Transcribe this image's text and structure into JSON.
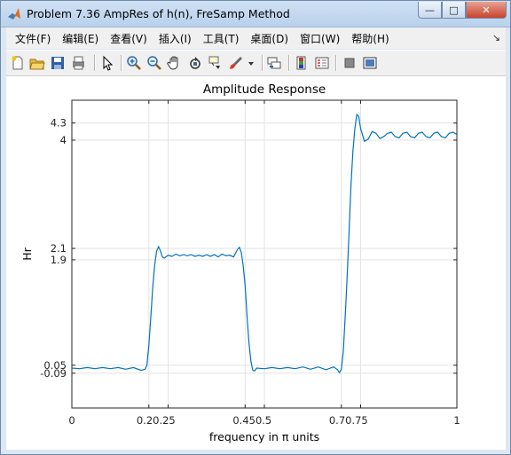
{
  "window": {
    "title": "Problem 7.36 AmpRes of h(n), FreSamp Method",
    "buttons": [
      "minimize",
      "maximize",
      "close"
    ]
  },
  "menu": [
    "文件(F)",
    "编辑(E)",
    "查看(V)",
    "插入(I)",
    "工具(T)",
    "桌面(D)",
    "窗口(W)",
    "帮助(H)"
  ],
  "toolbar": [
    "new-figure-icon",
    "open-icon",
    "save-icon",
    "print-icon",
    "pointer-icon",
    "zoom-in-icon",
    "zoom-out-icon",
    "pan-hand-icon",
    "rotate-3d-icon",
    "data-cursor-icon",
    "brush-icon",
    "brush-dropdown-icon",
    "link-plot-icon",
    "insert-colorbar-icon",
    "insert-legend-icon",
    "hide-plot-tools-icon",
    "show-plot-tools-icon"
  ],
  "chart_data": {
    "type": "line",
    "title": "Amplitude Response",
    "xlabel": "frequency in π units",
    "ylabel": "Hr",
    "xlim": [
      0,
      1
    ],
    "ylim": [
      -0.7,
      4.7
    ],
    "grid": true,
    "xticks": [
      0,
      0.2,
      0.25,
      0.45,
      0.5,
      0.7,
      0.75,
      1
    ],
    "xtick_labels": [
      "0",
      "0.20.25",
      "",
      "0.450.5",
      "",
      "0.70.75",
      "",
      "1"
    ],
    "yticks": [
      -0.09,
      0.05,
      1.9,
      2.1,
      4,
      4.3
    ],
    "ytick_labels": [
      "-0.09",
      "0.05",
      "1.9",
      "2.1",
      "4",
      "4.3"
    ],
    "series": [
      {
        "color": "#0072bd",
        "x": [
          0,
          0.02,
          0.04,
          0.06,
          0.08,
          0.1,
          0.12,
          0.14,
          0.16,
          0.18,
          0.19,
          0.195,
          0.2,
          0.205,
          0.21,
          0.215,
          0.22,
          0.225,
          0.23,
          0.235,
          0.24,
          0.25,
          0.26,
          0.27,
          0.28,
          0.29,
          0.3,
          0.31,
          0.32,
          0.33,
          0.34,
          0.35,
          0.36,
          0.37,
          0.38,
          0.39,
          0.4,
          0.41,
          0.42,
          0.43,
          0.435,
          0.44,
          0.445,
          0.45,
          0.455,
          0.46,
          0.465,
          0.47,
          0.475,
          0.48,
          0.5,
          0.52,
          0.54,
          0.56,
          0.58,
          0.6,
          0.62,
          0.64,
          0.66,
          0.68,
          0.69,
          0.695,
          0.7,
          0.705,
          0.71,
          0.715,
          0.72,
          0.725,
          0.73,
          0.735,
          0.74,
          0.745,
          0.75,
          0.76,
          0.77,
          0.78,
          0.79,
          0.8,
          0.81,
          0.82,
          0.83,
          0.84,
          0.85,
          0.86,
          0.87,
          0.88,
          0.89,
          0.9,
          0.91,
          0.92,
          0.93,
          0.94,
          0.95,
          0.96,
          0.97,
          0.98,
          0.99,
          1.0
        ],
        "y": [
          0.0,
          -0.01,
          0.01,
          -0.01,
          0.01,
          -0.01,
          0.01,
          -0.02,
          0.01,
          -0.04,
          -0.02,
          0.05,
          0.4,
          0.9,
          1.4,
          1.8,
          2.05,
          2.13,
          2.06,
          1.95,
          1.93,
          1.98,
          1.96,
          2.0,
          1.97,
          1.99,
          1.97,
          1.99,
          1.96,
          1.98,
          1.96,
          1.99,
          1.96,
          1.99,
          1.95,
          2.0,
          1.97,
          1.98,
          1.95,
          2.08,
          2.12,
          2.03,
          1.8,
          1.45,
          0.9,
          0.45,
          0.12,
          -0.04,
          -0.05,
          0.0,
          -0.01,
          0.01,
          -0.01,
          0.01,
          -0.01,
          0.02,
          -0.02,
          0.02,
          -0.03,
          0.02,
          -0.03,
          -0.08,
          -0.02,
          0.3,
          0.9,
          1.6,
          2.4,
          3.2,
          3.8,
          4.2,
          4.45,
          4.42,
          4.2,
          3.98,
          4.02,
          4.15,
          4.12,
          4.03,
          4.06,
          4.12,
          4.14,
          4.06,
          4.04,
          4.12,
          4.14,
          4.06,
          4.04,
          4.12,
          4.14,
          4.06,
          4.04,
          4.12,
          4.14,
          4.06,
          4.04,
          4.12,
          4.14,
          4.1
        ]
      }
    ]
  }
}
